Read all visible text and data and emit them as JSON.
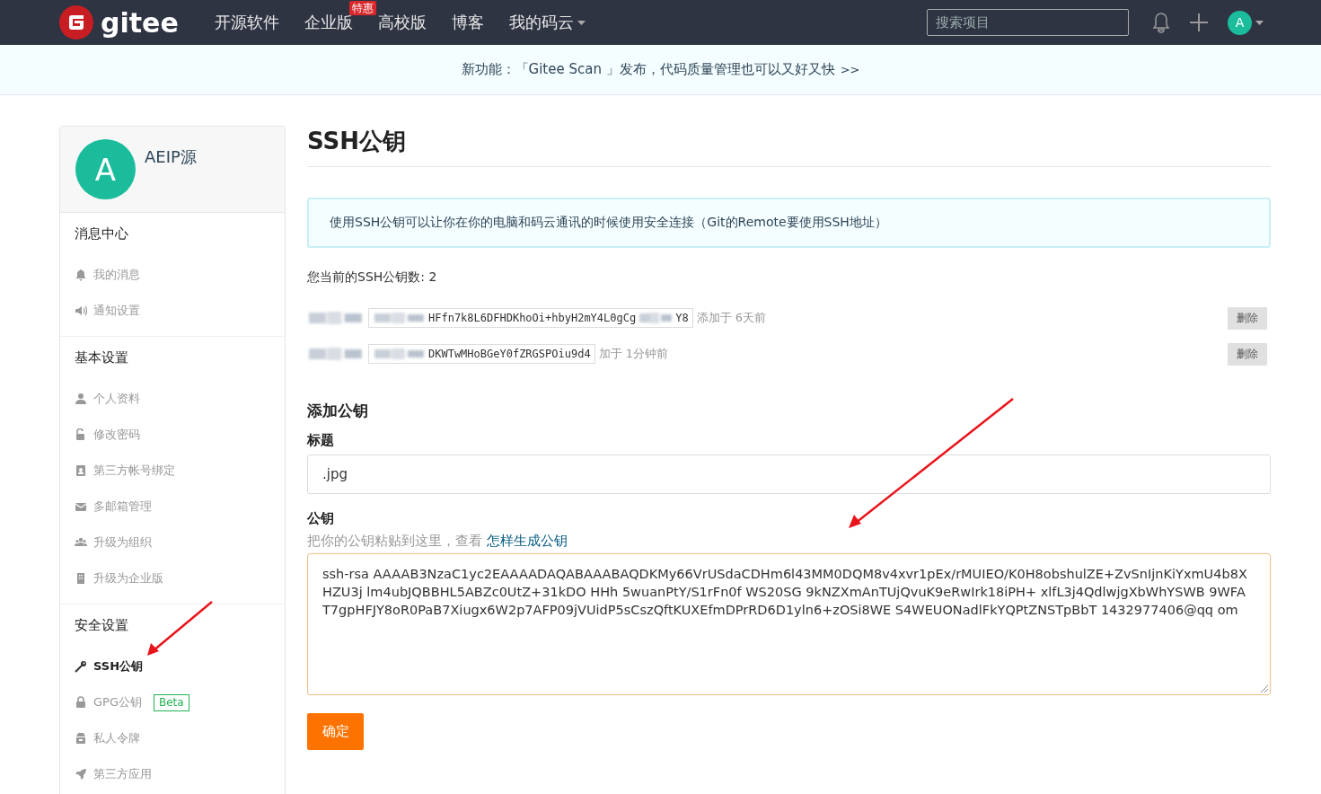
{
  "navbar": {
    "logo": "gitee",
    "items": [
      {
        "label": "开源软件"
      },
      {
        "label": "企业版",
        "badge": "特惠"
      },
      {
        "label": "高校版"
      },
      {
        "label": "博客"
      },
      {
        "label": "我的码云",
        "dropdown": true
      }
    ],
    "search": {
      "placeholder": "搜索项目"
    },
    "avatar": "A"
  },
  "banner": {
    "text": "新功能：「Gitee Scan 」发布，代码质量管理也可以又好又快",
    "link": ">>"
  },
  "sidebar": {
    "user": {
      "avatar": "A",
      "name": "AEIP源"
    },
    "sections": [
      {
        "title": "消息中心",
        "items": [
          {
            "label": "我的消息",
            "kind": "bell",
            "selected": false
          },
          {
            "label": "通知设置",
            "kind": "speaker",
            "selected": false
          }
        ]
      },
      {
        "title": "基本设置",
        "items": [
          {
            "label": "个人资料",
            "kind": "user",
            "selected": false
          },
          {
            "label": "修改密码",
            "kind": "unlock",
            "selected": false
          },
          {
            "label": "第三方帐号绑定",
            "kind": "card",
            "selected": false
          },
          {
            "label": "多邮箱管理",
            "kind": "mail",
            "selected": false
          },
          {
            "label": "升级为组织",
            "kind": "group",
            "selected": false
          },
          {
            "label": "升级为企业版",
            "kind": "building",
            "selected": false
          }
        ]
      },
      {
        "title": "安全设置",
        "items": [
          {
            "label": "SSH公钥",
            "kind": "key",
            "selected": true
          },
          {
            "label": "GPG公钥",
            "kind": "lock",
            "selected": false,
            "badge": "Beta"
          },
          {
            "label": "私人令牌",
            "kind": "token",
            "selected": false
          },
          {
            "label": "第三方应用",
            "kind": "rocket",
            "selected": false
          }
        ]
      }
    ]
  },
  "main": {
    "title": "SSH公钥",
    "alert": "使用SSH公钥可以让你在你的电脑和码云通讯的时候使用安全连接（Git的Remote要使用SSH地址）",
    "key_count": "您当前的SSH公钥数: 2",
    "keys": [
      {
        "key": "HFfn7k8L6DFHDKhoOi+hbyH2mY4L0gCg",
        "key_end": "Y8",
        "time": "添加于 6天前",
        "delete": "删除"
      },
      {
        "key": "DKWTwMHoBGeY0fZRGSPOiu9d4",
        "time": "加于 1分钟前",
        "delete": "删除"
      }
    ],
    "add": {
      "heading": "添加公钥",
      "title_label": "标题",
      "title_value": ".jpg",
      "key_label": "公钥",
      "hint": "把你的公钥粘贴到这里，查看",
      "hint_link": "怎样生成公钥",
      "key_value": "ssh-rsa AAAAB3NzaC1yc2EAAAADAQABAAABAQDKMy66VrUSdaCDHm6l43MM0DQM8v4xvr1pEx/rMUIEO/K0H8obshulZE+ZvSnIjnKiYxmU4b8XHZU3j lm4ubJQBBHL5ABZc0UtZ+31kDO HHh 5wuanPtY/S1rFn0f WS20SG 9kNZXmAnTUjQvuK9eRwIrk18iPH+ xlfL3j4QdlwjgXbWhYSWB 9WFA T7gpHFJY8oR0PaB7Xiugx6W2p7AFP09jVUidP5sCszQftKUXEfmDPrRD6D1yln6+zOSi8WE S4WEUONadlFkYQPtZNSTpBbT 1432977406@qq om",
      "submit": "确定"
    }
  }
}
